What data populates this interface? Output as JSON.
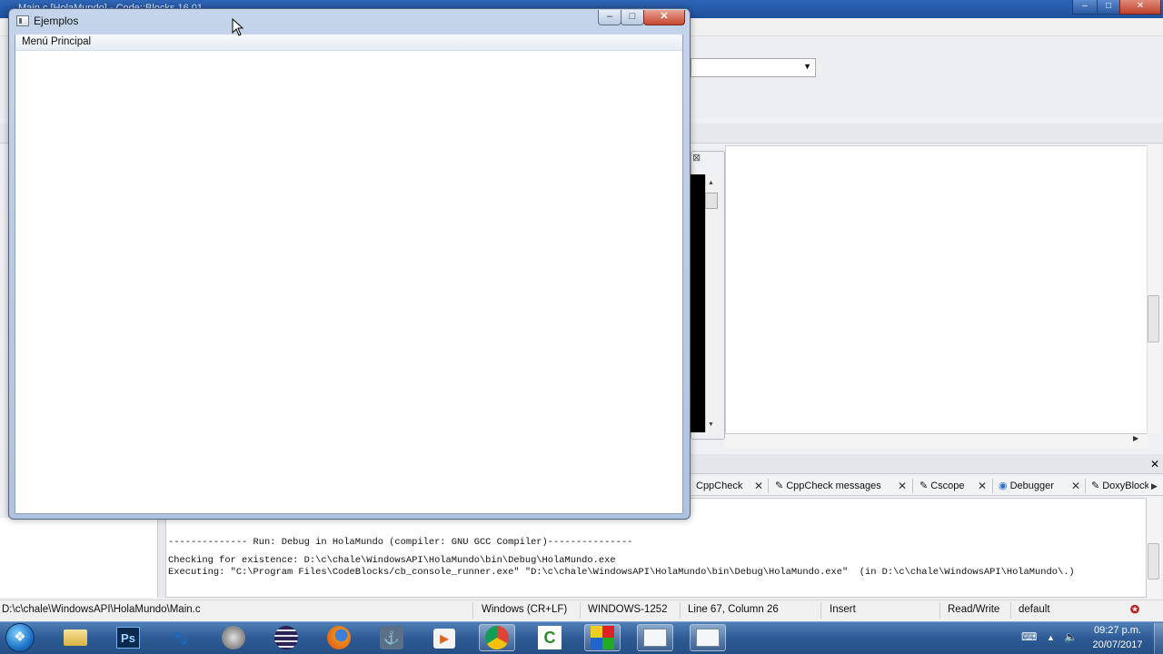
{
  "background_app": {
    "title": "Main.c [HolaMundo] - Code::Blocks 16.01",
    "statusbar": {
      "path": "D:\\c\\chale\\WindowsAPI\\HolaMundo\\Main.c",
      "line_endings": "Windows (CR+LF)",
      "encoding": "WINDOWS-1252",
      "position": "Line 67, Column 26",
      "insert_mode": "Insert",
      "access": "Read/Write",
      "profile": "default"
    },
    "log_tabs": [
      {
        "label": "CppCheck",
        "icon": "cppcheck-icon"
      },
      {
        "label": "CppCheck messages",
        "icon": "pencil-icon"
      },
      {
        "label": "Cscope",
        "icon": "pencil-icon"
      },
      {
        "label": "Debugger",
        "icon": "debugger-icon"
      },
      {
        "label": "DoxyBlocks",
        "icon": "pencil-icon"
      }
    ],
    "build_log": [
      "-------------- Run: Debug in HolaMundo (compiler: GNU GCC Compiler)---------------",
      "Checking for existence: D:\\c\\chale\\WindowsAPI\\HolaMundo\\bin\\Debug\\HolaMundo.exe",
      "Executing: \"C:\\Program Files\\CodeBlocks/cb_console_runner.exe\" \"D:\\c\\chale\\WindowsAPI\\HolaMundo\\bin\\Debug\\HolaMundo.exe\"  (in D:\\c\\chale\\WindowsAPI\\HolaMundo\\.)"
    ]
  },
  "app_window": {
    "title": "Ejemplos",
    "menu": [
      "Menú Principal"
    ],
    "buttons": {
      "minimize": "–",
      "maximize": "□",
      "close": "✕"
    }
  },
  "taskbar": {
    "apps": [
      {
        "name": "explorer",
        "icon": "folder-icon"
      },
      {
        "name": "photoshop",
        "icon": "photoshop-icon",
        "label": "Ps"
      },
      {
        "name": "gimp",
        "icon": "gimp-icon"
      },
      {
        "name": "media",
        "icon": "media-icon"
      },
      {
        "name": "eclipse",
        "icon": "eclipse-icon"
      },
      {
        "name": "firefox",
        "icon": "firefox-icon"
      },
      {
        "name": "mysql-workbench",
        "icon": "workbench-icon"
      },
      {
        "name": "player",
        "icon": "play-icon"
      },
      {
        "name": "chrome",
        "icon": "chrome-icon"
      },
      {
        "name": "camtasia",
        "icon": "camtasia-icon"
      },
      {
        "name": "codeblocks",
        "icon": "codeblocks-icon"
      },
      {
        "name": "window-1",
        "icon": "window-icon"
      },
      {
        "name": "window-2",
        "icon": "window-icon"
      }
    ],
    "clock": {
      "time": "09:27 p.m.",
      "date": "20/07/2017"
    }
  }
}
